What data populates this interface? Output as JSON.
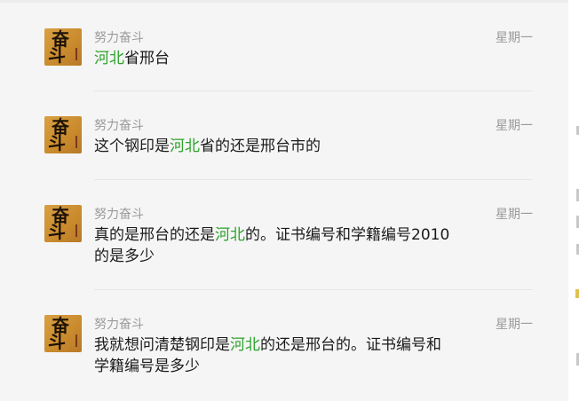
{
  "conversation": {
    "items": [
      {
        "name": "努力奋斗",
        "date": "星期一",
        "avatar_glyphs": [
          "奋",
          "斗"
        ],
        "message_segments": [
          {
            "text": "河北",
            "highlight": true
          },
          {
            "text": "省邢台",
            "highlight": false
          }
        ]
      },
      {
        "name": "努力奋斗",
        "date": "星期一",
        "avatar_glyphs": [
          "奋",
          "斗"
        ],
        "message_segments": [
          {
            "text": "这个钢印是",
            "highlight": false
          },
          {
            "text": "河北",
            "highlight": true
          },
          {
            "text": "省的还是邢台市的",
            "highlight": false
          }
        ]
      },
      {
        "name": "努力奋斗",
        "date": "星期一",
        "avatar_glyphs": [
          "奋",
          "斗"
        ],
        "message_segments": [
          {
            "text": "真的是邢台的还是",
            "highlight": false
          },
          {
            "text": "河北",
            "highlight": true
          },
          {
            "text": "的。证书编号和学籍编号2010的是多少",
            "highlight": false
          }
        ]
      },
      {
        "name": "努力奋斗",
        "date": "星期一",
        "avatar_glyphs": [
          "奋",
          "斗"
        ],
        "message_segments": [
          {
            "text": "我就想问清楚钢印是",
            "highlight": false
          },
          {
            "text": "河北",
            "highlight": true
          },
          {
            "text": "的还是邢台的。证书编号和学籍编号是多少",
            "highlight": false
          }
        ]
      }
    ]
  },
  "colors": {
    "background": "#f5f5f5",
    "highlight": "#2aa32a",
    "meta_text": "#9a9a9a",
    "message_text": "#1a1a1a",
    "avatar": "#d8a042"
  }
}
